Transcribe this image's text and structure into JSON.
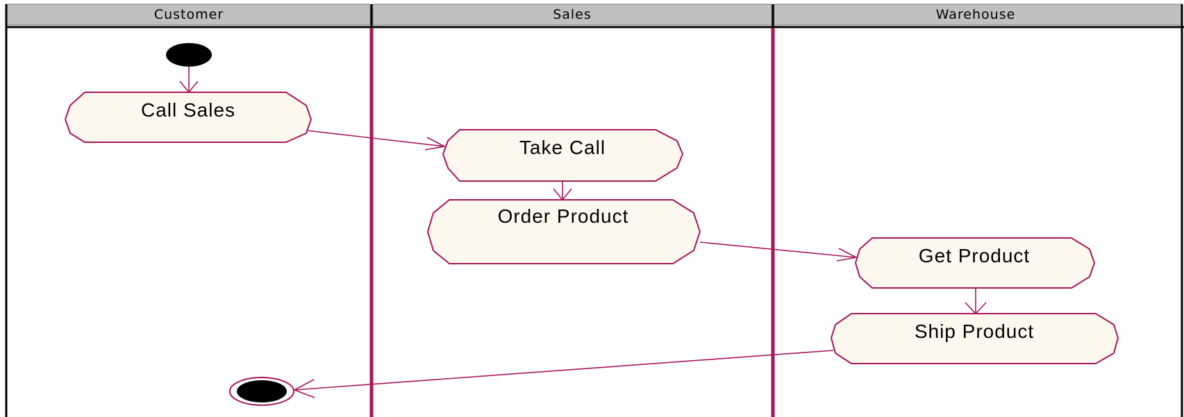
{
  "lanes": [
    {
      "name": "Customer"
    },
    {
      "name": "Sales"
    },
    {
      "name": "Warehouse"
    }
  ],
  "activities": {
    "call_sales": "Call Sales",
    "take_call": "Take Call",
    "order_product": "Order Product",
    "get_product": "Get Product",
    "ship_product": "Ship Product"
  },
  "colors": {
    "accent": "#a8155a",
    "node_fill": "#fdf8ee",
    "header_bg": "#c0c0c0"
  }
}
